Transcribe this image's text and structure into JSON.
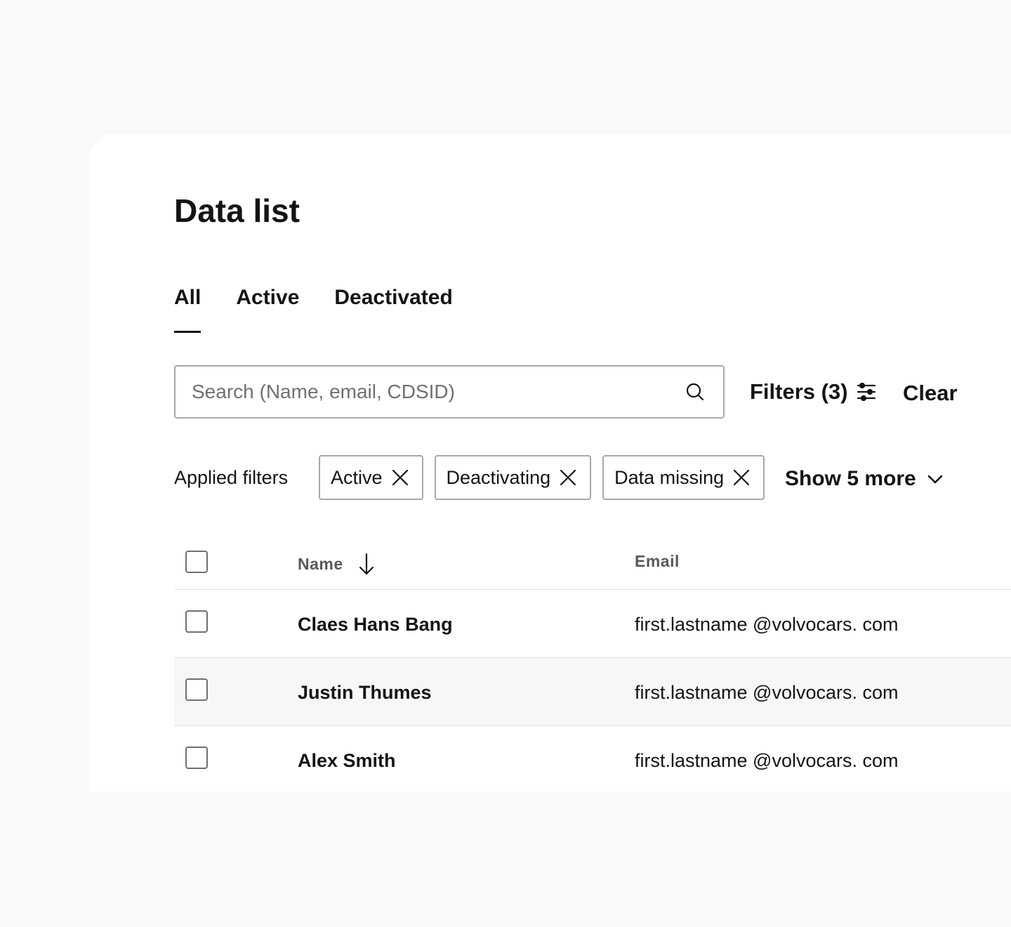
{
  "page": {
    "title": "Data list"
  },
  "tabs": [
    {
      "label": "All",
      "active": true
    },
    {
      "label": "Active",
      "active": false
    },
    {
      "label": "Deactivated",
      "active": false
    }
  ],
  "search": {
    "placeholder": "Search (Name, email, CDSID)",
    "value": "",
    "icon": "search-icon"
  },
  "toolbar": {
    "filters_label": "Filters (3)",
    "filters_icon": "sliders-icon",
    "clear_label": "Clear"
  },
  "applied_filters": {
    "label": "Applied filters",
    "chips": [
      {
        "label": "Active"
      },
      {
        "label": "Deactivating"
      },
      {
        "label": "Data missing"
      }
    ],
    "show_more_label": "Show 5 more",
    "show_more_icon": "chevron-down-icon"
  },
  "table": {
    "columns": [
      {
        "label": "Name",
        "sort": "descending"
      },
      {
        "label": "Email"
      }
    ],
    "rows": [
      {
        "name": "Claes Hans Bang",
        "email": "first.lastname @volvocars. com",
        "checked": false
      },
      {
        "name": "Justin Thumes",
        "email": "first.lastname @volvocars. com",
        "checked": false
      },
      {
        "name": "Alex Smith",
        "email": "first.lastname @volvocars. com",
        "checked": false
      }
    ]
  },
  "colors": {
    "background": "#f9f9f9",
    "surface": "#ffffff",
    "text": "#141414",
    "muted_text": "#595959",
    "border": "#a8a8a8",
    "row_alt": "#f7f7f7"
  }
}
